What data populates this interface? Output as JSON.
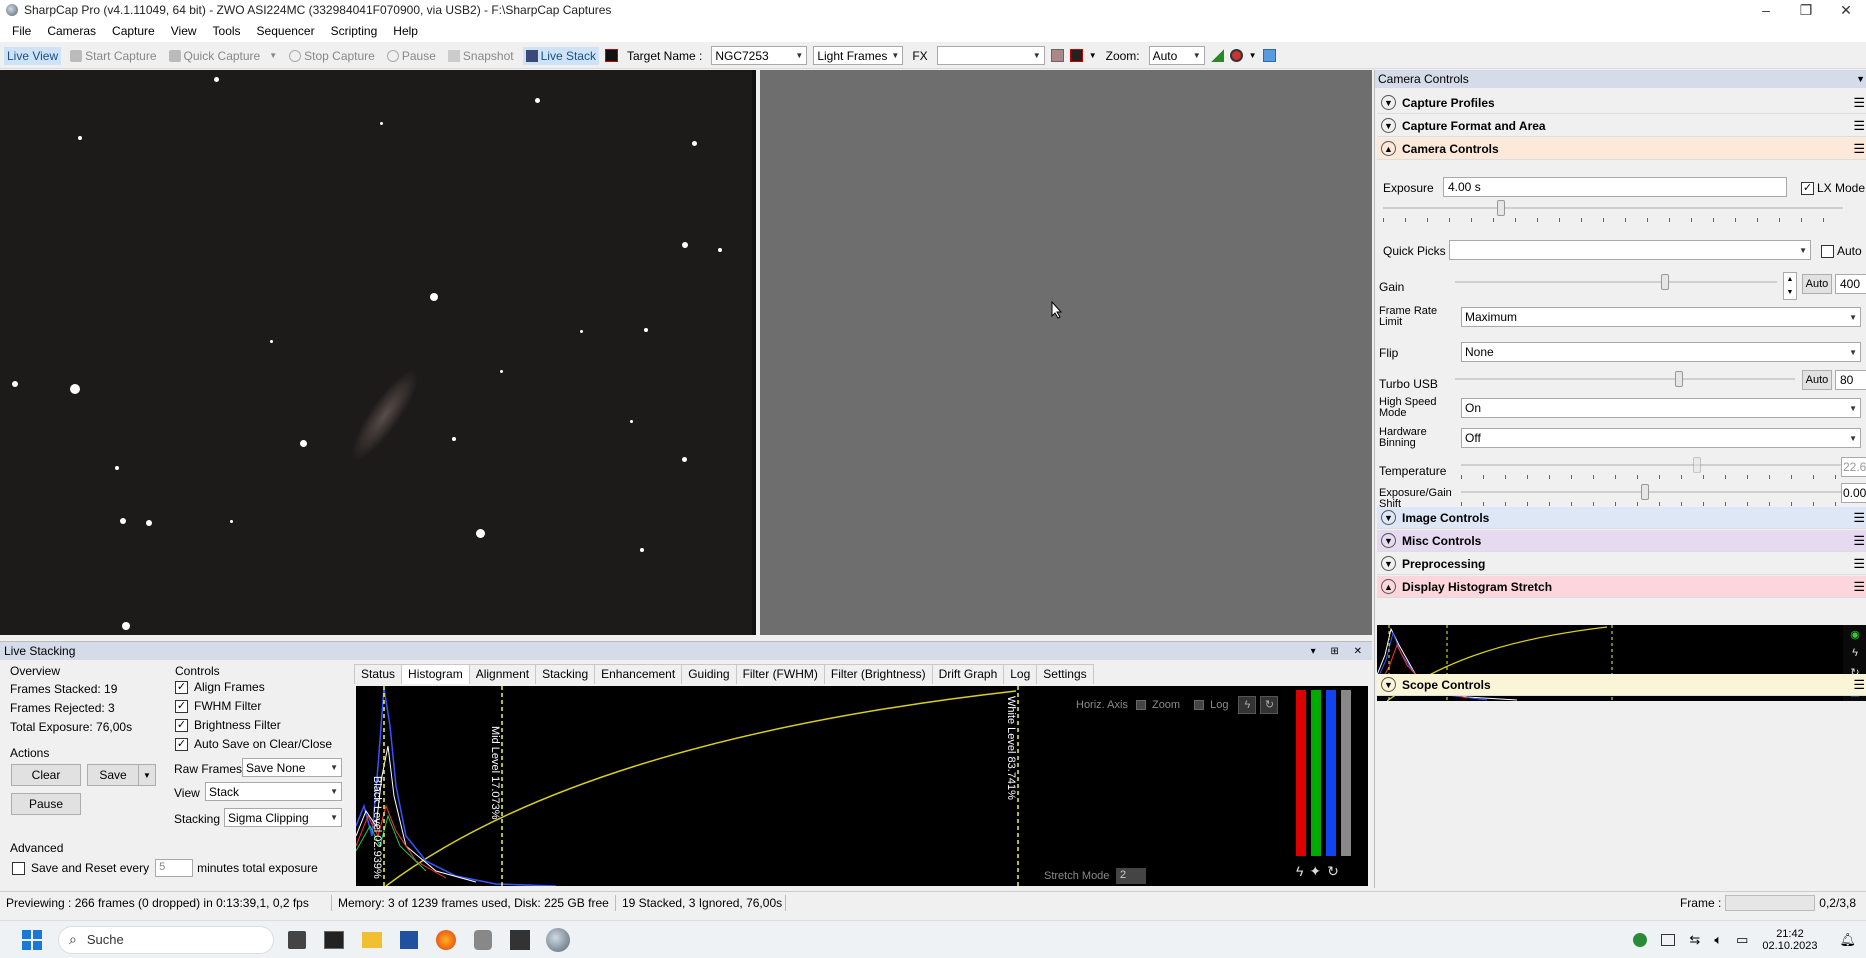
{
  "window": {
    "title": "SharpCap Pro (v4.1.11049, 64 bit) - ZWO ASI224MC (332984041F070900, via USB2) - F:\\SharpCap Captures",
    "controls": [
      "–",
      "❐",
      "✕"
    ]
  },
  "menu": [
    "File",
    "Cameras",
    "Capture",
    "View",
    "Tools",
    "Sequencer",
    "Scripting",
    "Help"
  ],
  "toolbar": {
    "live_view": "Live View",
    "start_capture": "Start Capture",
    "quick_capture": "Quick Capture",
    "stop_capture": "Stop Capture",
    "pause": "Pause",
    "snapshot": "Snapshot",
    "live_stack": "Live Stack",
    "target_name_label": "Target Name :",
    "target_name_value": "NGC7253",
    "frame_type": "Light Frames",
    "fx_label": "FX",
    "fx_value": "",
    "zoom_label": "Zoom:",
    "zoom_value": "Auto"
  },
  "live_stacking": {
    "title": "Live Stacking",
    "overview_title": "Overview",
    "frames_stacked": "Frames Stacked:  19",
    "frames_rejected": "Frames Rejected: 3",
    "total_exposure": "Total Exposure:   76,00s",
    "actions_title": "Actions",
    "clear": "Clear",
    "save": "Save",
    "pause": "Pause",
    "advanced_title": "Advanced",
    "save_reset_label": "Save and Reset every",
    "save_reset_value": "5",
    "save_reset_suffix": "minutes total exposure",
    "controls_title": "Controls",
    "align_frames": "Align Frames",
    "fwhm_filter": "FWHM Filter",
    "brightness_filter": "Brightness Filter",
    "auto_save": "Auto Save on Clear/Close",
    "raw_frames_label": "Raw Frames",
    "raw_frames_value": "Save None",
    "view_label": "View",
    "view_value": "Stack",
    "stacking_label": "Stacking",
    "stacking_value": "Sigma Clipping",
    "tabs": [
      "Status",
      "Histogram",
      "Alignment",
      "Stacking",
      "Enhancement",
      "Guiding",
      "Filter (FWHM)",
      "Filter (Brightness)",
      "Drift Graph",
      "Log",
      "Settings"
    ],
    "histogram": {
      "black_level": "Black Level  02.939%",
      "mid_level": "Mid Level  17.073%",
      "white_level": "White Level  83.741%",
      "horiz_axis": "Horiz. Axis",
      "zoom": "Zoom",
      "log": "Log",
      "stretch_mode": "Stretch Mode",
      "stretch_value": "2"
    }
  },
  "camera_controls": {
    "panel_title": "Camera Controls",
    "sections": {
      "capture_profiles": "Capture Profiles",
      "capture_format": "Capture Format and Area",
      "camera_controls": "Camera Controls",
      "image_controls": "Image Controls",
      "misc_controls": "Misc Controls",
      "preprocessing": "Preprocessing",
      "display_histogram": "Display Histogram Stretch",
      "scope_controls": "Scope Controls"
    },
    "exposure_label": "Exposure",
    "exposure_value": "4.00 s",
    "lx_mode": "LX Mode",
    "quick_picks_label": "Quick Picks",
    "quick_picks_auto": "Auto",
    "gain_label": "Gain",
    "gain_auto": "Auto",
    "gain_value": "400",
    "frame_rate_label": "Frame Rate Limit",
    "frame_rate_value": "Maximum",
    "flip_label": "Flip",
    "flip_value": "None",
    "turbo_usb_label": "Turbo USB",
    "turbo_auto": "Auto",
    "turbo_value": "80",
    "high_speed_label": "High Speed Mode",
    "high_speed_value": "On",
    "hw_binning_label": "Hardware Binning",
    "hw_binning_value": "Off",
    "temperature_label": "Temperature",
    "temperature_value": "22.6",
    "exp_gain_shift_label": "Exposure/Gain Shift",
    "exp_gain_shift_value": "0.00"
  },
  "status_bar": {
    "previewing": "Previewing : 266 frames (0 dropped) in 0:13:39,1, 0,2 fps",
    "memory": "Memory: 3 of 1239 frames used, Disk: 225 GB free",
    "stacked": "19 Stacked, 3 Ignored, 76,00s",
    "frame_label": "Frame :",
    "frame_value": "0,2/3,8"
  },
  "taskbar": {
    "search": "Suche",
    "time": "21:42",
    "date": "02.10.2023"
  }
}
